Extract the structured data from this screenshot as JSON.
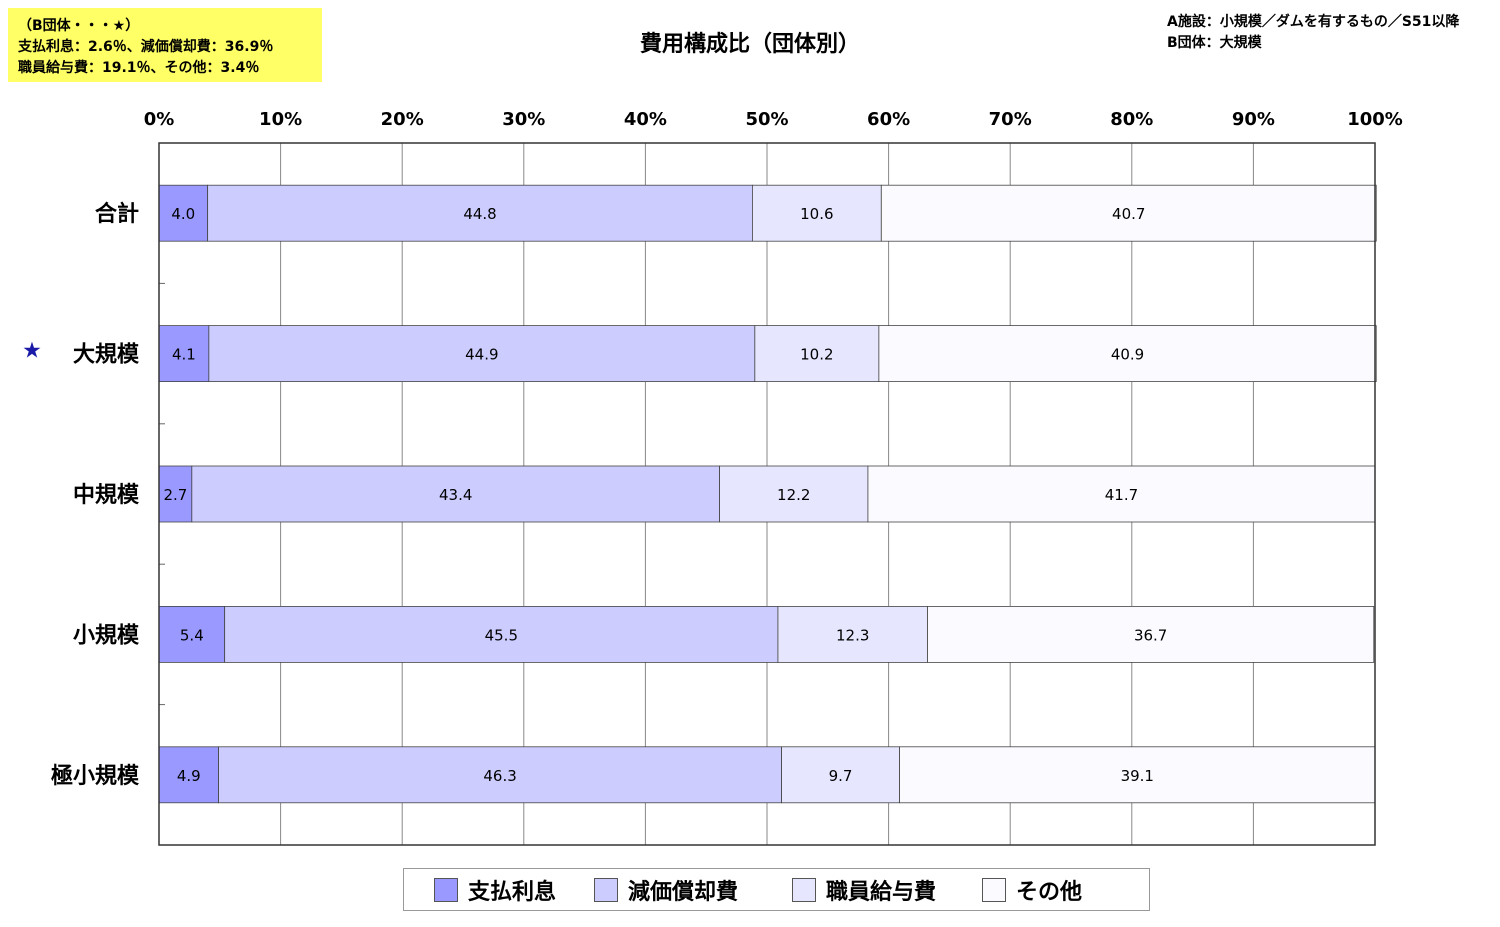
{
  "note": {
    "lines": [
      "（B団体・・・★）",
      "支払利息：2.6％、減価償却費：36.9％",
      "職員給与費：19.1％、その他：3.4％"
    ]
  },
  "info": {
    "lines": [
      "A施設：小規模／ダムを有するもの／S51以降",
      "B団体：大規模"
    ]
  },
  "colors": {
    "series": [
      "#9999ff",
      "#ccccff",
      "#e6e6ff",
      "#fafaff"
    ],
    "star": "#1a1aa6",
    "note_bg": "#ffff66"
  },
  "chart_data": {
    "type": "bar",
    "orientation": "horizontal",
    "stacked": true,
    "title": "費用構成比（団体別）",
    "categories": [
      "合計",
      "大規模",
      "中規模",
      "小規模",
      "極小規模"
    ],
    "highlight": {
      "category": "大規模",
      "marker": "★"
    },
    "xlim": [
      0,
      100
    ],
    "xticks": [
      "0%",
      "10%",
      "20%",
      "30%",
      "40%",
      "50%",
      "60%",
      "70%",
      "80%",
      "90%",
      "100%"
    ],
    "grid": true,
    "legend": "bottom",
    "series": [
      {
        "name": "支払利息",
        "values": [
          4.0,
          4.1,
          2.7,
          5.4,
          4.9
        ],
        "labels": [
          "4.0",
          "4.1",
          "2.7",
          "5.4",
          "4.9"
        ]
      },
      {
        "name": "減価償却費",
        "values": [
          44.8,
          44.9,
          43.4,
          45.5,
          46.3
        ],
        "labels": [
          "44.8",
          "44.9",
          "43.4",
          "45.5",
          "46.3"
        ]
      },
      {
        "name": "職員給与費",
        "values": [
          10.6,
          10.2,
          12.2,
          12.3,
          9.7
        ],
        "labels": [
          "10.6",
          "10.2",
          "12.2",
          "12.3",
          "9.7"
        ]
      },
      {
        "name": "その他",
        "values": [
          40.7,
          40.9,
          41.7,
          36.7,
          39.1
        ],
        "labels": [
          "40.7",
          "40.9",
          "41.7",
          "36.7",
          "39.1"
        ]
      }
    ]
  }
}
